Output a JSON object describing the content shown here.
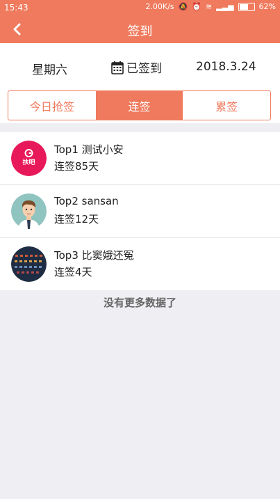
{
  "status_bar": {
    "time": "15:43",
    "network_speed": "2.00K/s",
    "battery": "62%",
    "battery_level": 0.62
  },
  "header": {
    "title": "签到",
    "back_icon": "chevron-left-icon"
  },
  "info": {
    "weekday": "星期六",
    "signed_icon": "calendar-icon",
    "signed_label": "已签到",
    "date": "2018.3.24"
  },
  "tabs": [
    {
      "label": "今日抢签",
      "active": false
    },
    {
      "label": "连签",
      "active": true
    },
    {
      "label": "累签",
      "active": false
    }
  ],
  "ranking": [
    {
      "name": "Top1 测试小安",
      "streak": "连签85天",
      "avatar_icon": "brand-logo-avatar"
    },
    {
      "name": "Top2 sansan",
      "streak": "连签12天",
      "avatar_icon": "cartoon-man-avatar"
    },
    {
      "name": "Top3 比窦娥还冤",
      "streak": "连签4天",
      "avatar_icon": "dark-screenshot-avatar"
    }
  ],
  "footer": {
    "no_more": "没有更多数据了"
  },
  "colors": {
    "accent": "#f07a5d",
    "background": "#efeff3"
  }
}
